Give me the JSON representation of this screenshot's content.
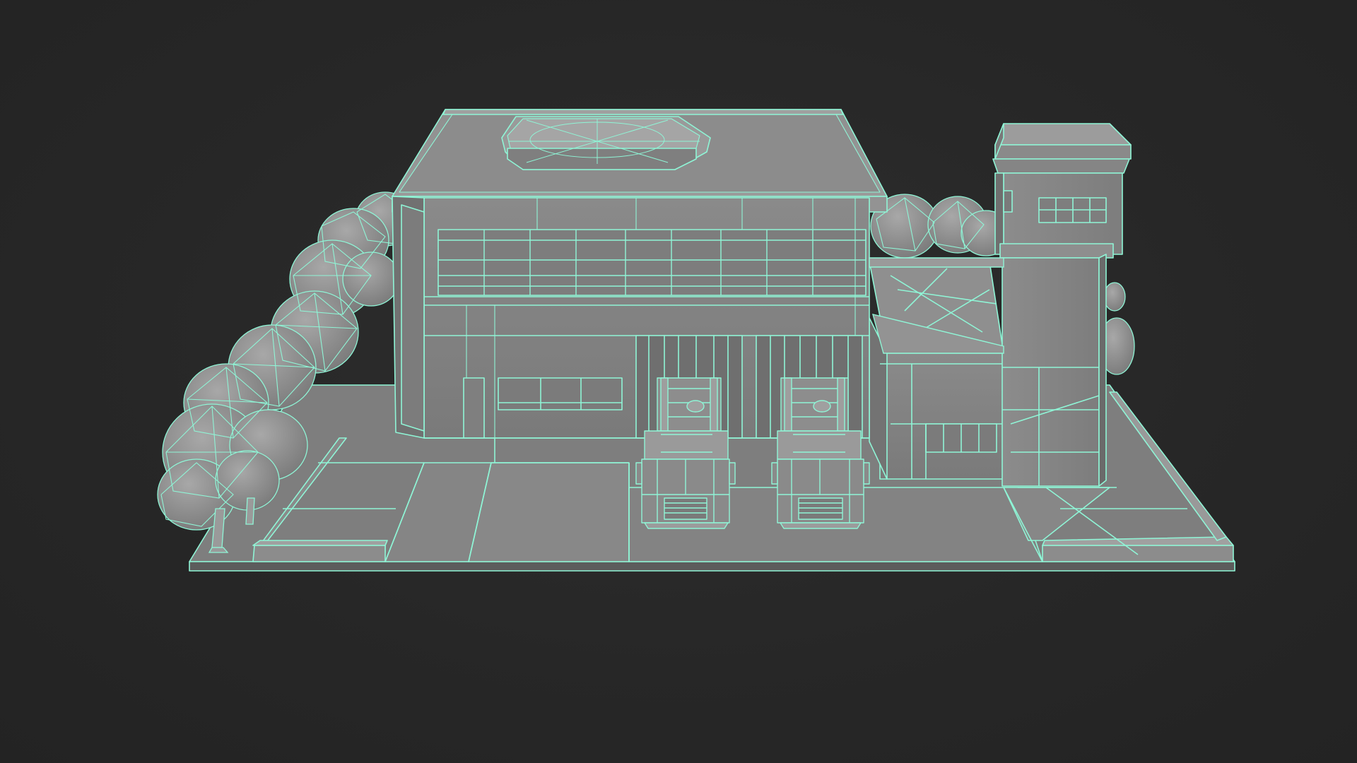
{
  "scene": {
    "description_hidden": "",
    "colors": {
      "background": "#262626",
      "surface": "#8e8e8e",
      "surface_light": "#a3a3a3",
      "surface_dark": "#747474",
      "surface_shadow": "#5e5e5e",
      "wire": "#8ff5d6",
      "wire_dim": "#6fd9bb"
    }
  }
}
